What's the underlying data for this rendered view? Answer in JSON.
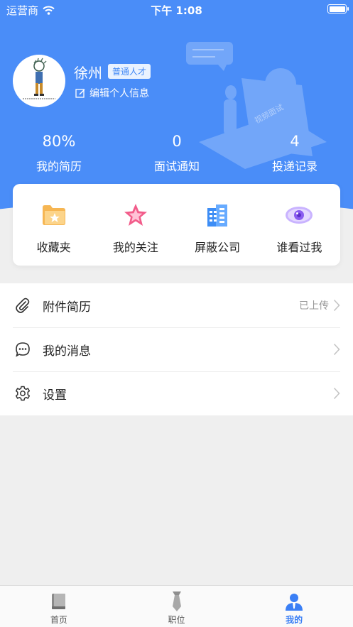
{
  "status_bar": {
    "carrier": "运营商",
    "time": "下午 1:08"
  },
  "profile": {
    "name": "徐州",
    "badge": "普通人才",
    "edit_label": "编辑个人信息",
    "illustration_text": "视频面试"
  },
  "stats": [
    {
      "value": "80%",
      "label": "我的简历"
    },
    {
      "value": "0",
      "label": "面试通知"
    },
    {
      "value": "4",
      "label": "投递记录"
    }
  ],
  "quick_actions": [
    {
      "label": "收藏夹",
      "icon": "folder-star-icon"
    },
    {
      "label": "我的关注",
      "icon": "star-icon"
    },
    {
      "label": "屏蔽公司",
      "icon": "building-icon"
    },
    {
      "label": "谁看过我",
      "icon": "eye-icon"
    }
  ],
  "menu": [
    {
      "label": "附件简历",
      "status": "已上传",
      "icon": "paperclip-icon"
    },
    {
      "label": "我的消息",
      "status": "",
      "icon": "chat-bubble-icon"
    },
    {
      "label": "设置",
      "status": "",
      "icon": "gear-icon"
    }
  ],
  "tabs": [
    {
      "label": "首页",
      "icon": "book-icon",
      "active": false
    },
    {
      "label": "职位",
      "icon": "tie-icon",
      "active": false
    },
    {
      "label": "我的",
      "icon": "user-icon",
      "active": true
    }
  ],
  "colors": {
    "brand_blue": "#4a8df8",
    "active_tab": "#3a7ff5",
    "background": "#efefef"
  }
}
